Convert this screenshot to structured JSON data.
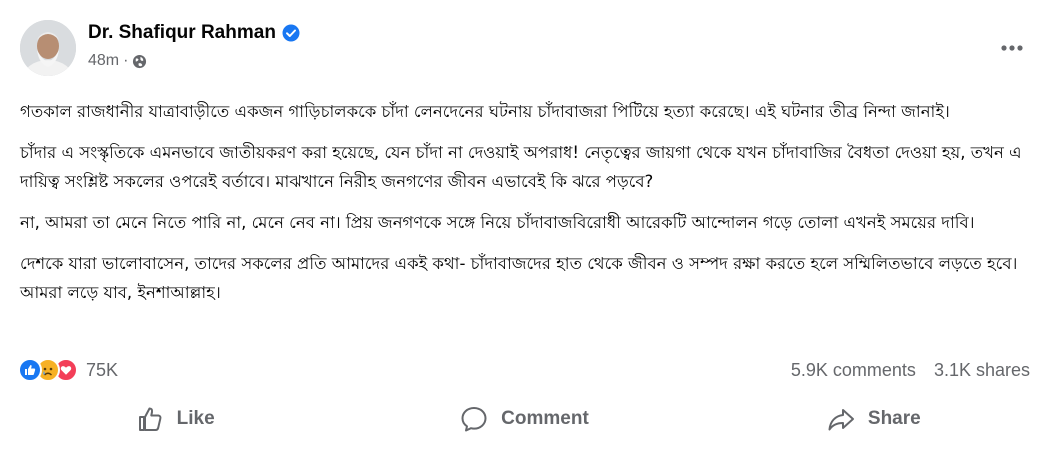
{
  "post": {
    "author": "Dr. Shafiqur Rahman",
    "time": "48m",
    "paragraphs": [
      "গতকাল রাজধানীর যাত্রাবাড়ীতে একজন গাড়িচালককে চাঁদা লেনদেনের ঘটনায় চাঁদাবাজরা পিটিয়ে হত্যা করেছে। এই ঘটনার তীব্র নিন্দা জানাই।",
      "চাঁদার এ সংস্কৃতিকে এমনভাবে জাতীয়করণ করা হয়েছে, যেন চাঁদা না দেওয়াই অপরাধ! নেতৃত্বের জায়গা থেকে যখন চাঁদাবাজির বৈধতা দেওয়া হয়, তখন এ দায়িত্ব সংশ্লিষ্ট সকলের ওপরেই বর্তাবে। মাঝখানে নিরীহ জনগণের জীবন এভাবেই কি ঝরে পড়বে?",
      "না, আমরা তা মেনে নিতে পারি না, মেনে নেব না। প্রিয় জনগণকে সঙ্গে নিয়ে চাঁদাবাজবিরোধী আরেকটি আন্দোলন গড়ে তোলা এখনই সময়ের দাবি।",
      "দেশকে যারা ভালোবাসেন, তাদের সকলের প্রতি আমাদের একই কথা- চাঁদাবাজদের হাত থেকে জীবন ও সম্পদ রক্ষা করতে হলে সম্মিলিতভাবে লড়তে হবে। আমরা লড়ে যাব, ইনশাআল্লাহ।"
    ]
  },
  "stats": {
    "reactions_count": "75K",
    "comments": "5.9K comments",
    "shares": "3.1K shares"
  },
  "actions": {
    "like": "Like",
    "comment": "Comment",
    "share": "Share"
  },
  "colors": {
    "text": "#050505",
    "secondary": "#65676b",
    "like_blue": "#1877f2",
    "love_red": "#f33e58",
    "sad_yellow": "#f7b125"
  }
}
